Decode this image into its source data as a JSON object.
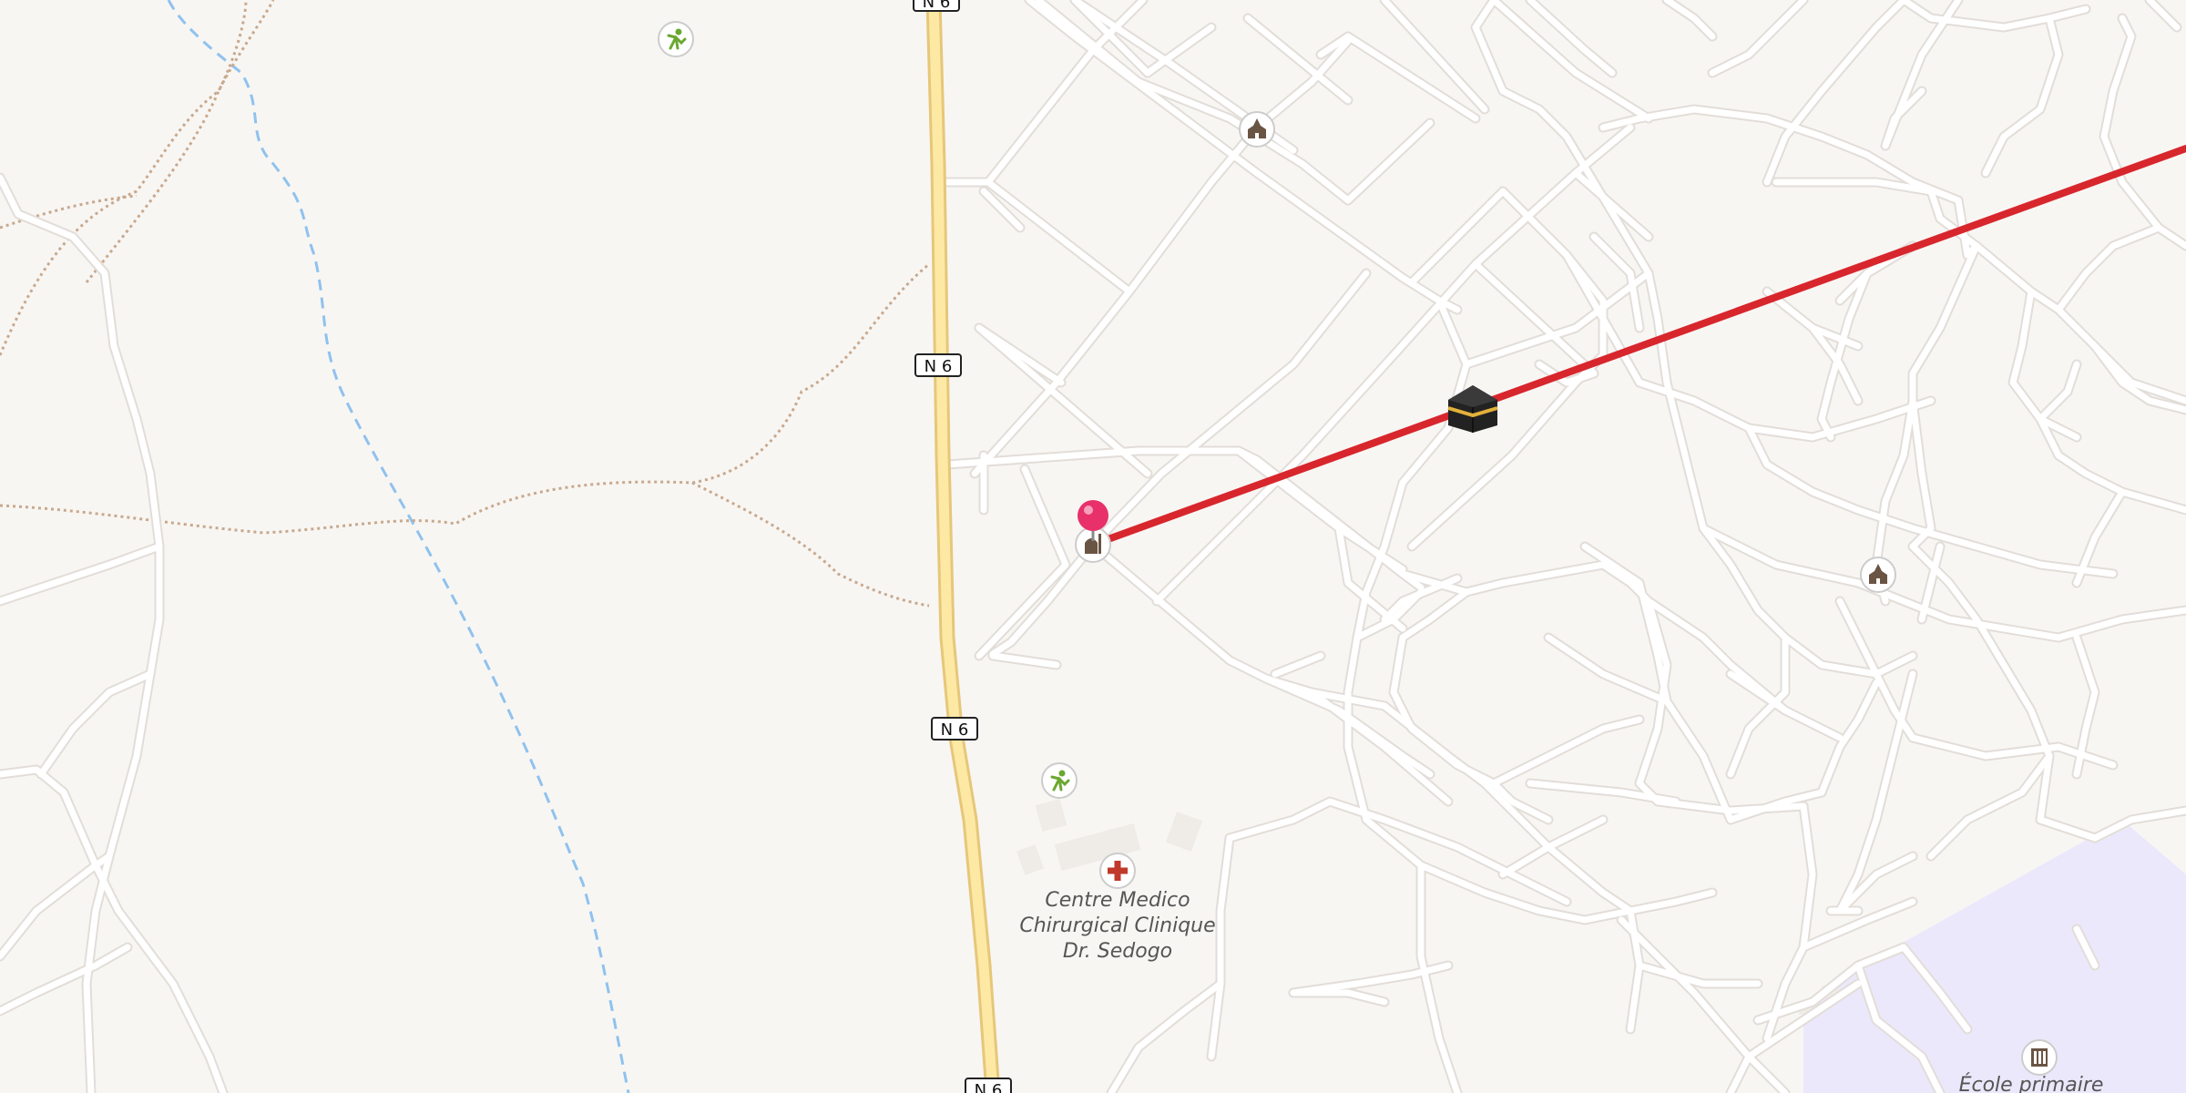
{
  "map": {
    "colors": {
      "background": "#f8f6f3",
      "road": "#ffffff",
      "road_casing": "#e2ddd8",
      "highway_fill": "#fde9a4",
      "highway_casing": "#e6c77a",
      "waterway": "#8fc2ee",
      "path": "#c8a98e",
      "school_area": "#ece8fb",
      "route": "#d8262d",
      "marker": "#e8306a"
    },
    "road_shields": [
      "N 6",
      "N 6",
      "N 6",
      "N 6"
    ],
    "pois": [
      {
        "icon": "sports-icon",
        "name": ""
      },
      {
        "icon": "sports-icon",
        "name": ""
      },
      {
        "icon": "place-of-worship-icon",
        "name": ""
      },
      {
        "icon": "place-of-worship-icon",
        "name": ""
      },
      {
        "icon": "mosque-icon",
        "name": ""
      },
      {
        "icon": "hospital-icon",
        "name": "Centre Medico Chirurgical Clinique Dr. Sedogo"
      },
      {
        "icon": "school-icon",
        "name": "École primaire"
      }
    ],
    "labels": {
      "clinic_line1": "Centre Medico",
      "clinic_line2": "Chirurgical Clinique",
      "clinic_line3": "Dr. Sedogo",
      "school": "École primaire"
    },
    "route_markers": {
      "start_icon": "location-pin-icon",
      "destination_icon": "kaaba-icon"
    }
  }
}
